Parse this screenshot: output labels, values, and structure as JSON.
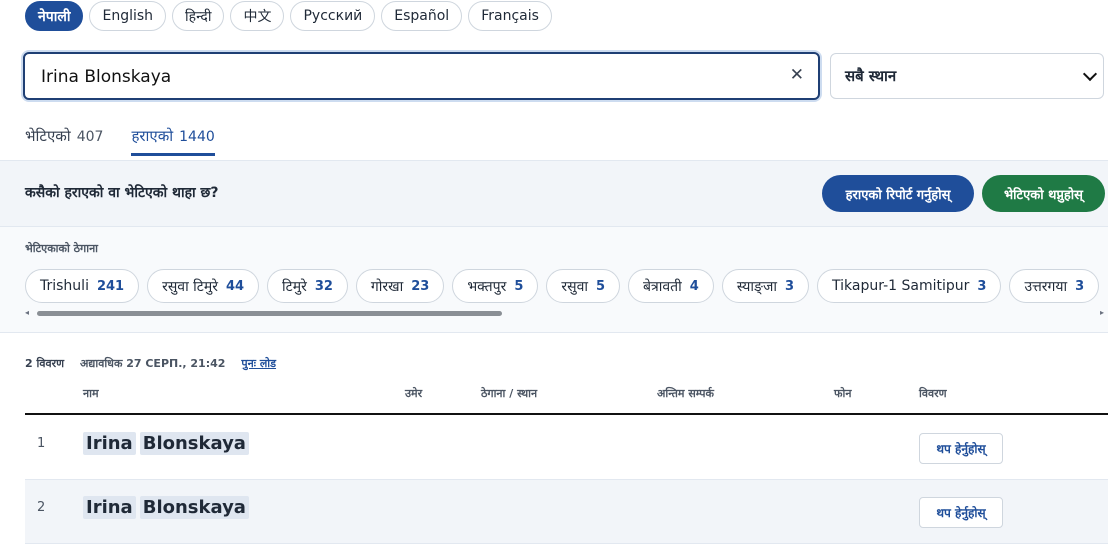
{
  "languages": [
    "नेपाली",
    "English",
    "हिन्दी",
    "中文",
    "Русский",
    "Español",
    "Français"
  ],
  "search": {
    "value": "Irina Blonskaya"
  },
  "location_select": {
    "selected": "सबै स्थान"
  },
  "tabs": [
    {
      "label": "भेटिएको",
      "count": "407"
    },
    {
      "label": "हराएको",
      "count": "1440"
    }
  ],
  "banner": {
    "question": "कसैको हराएको वा भेटिएको थाहा छ?",
    "report_button": "हराएको रिपोर्ट गर्नुहोस्",
    "found_button": "भेटिएको थप्नुहोस्"
  },
  "locations": {
    "title": "भेटिएकाको ठेगाना",
    "chips": [
      {
        "name": "Trishuli",
        "count": "241"
      },
      {
        "name": "रसुवा टिमुरे",
        "count": "44"
      },
      {
        "name": "टिमुरे",
        "count": "32"
      },
      {
        "name": "गोरखा",
        "count": "23"
      },
      {
        "name": "भक्तपुर",
        "count": "5"
      },
      {
        "name": "रसुवा",
        "count": "5"
      },
      {
        "name": "बेत्रावती",
        "count": "4"
      },
      {
        "name": "स्याङ्जा",
        "count": "3"
      },
      {
        "name": "Tikapur-1 Samitipur",
        "count": "3"
      },
      {
        "name": "उत्तरगया",
        "count": "3"
      }
    ]
  },
  "results": {
    "count_text": "2 विवरण",
    "updated_text": "अद्यावधिक 27 СЕРП., 21:42",
    "reload_text": "पुनः लोड",
    "headers": {
      "name": "नाम",
      "age": "उमेर",
      "address": "ठेगाना / स्थान",
      "last_contact": "अन्तिम सम्पर्क",
      "phone": "फोन",
      "details": "विवरण"
    },
    "rows": [
      {
        "index": "1",
        "first": "Irina",
        "last": "Blonskaya",
        "more": "थप हेर्नुहोस्"
      },
      {
        "index": "2",
        "first": "Irina",
        "last": "Blonskaya",
        "more": "थप हेर्नुहोस्"
      }
    ]
  }
}
